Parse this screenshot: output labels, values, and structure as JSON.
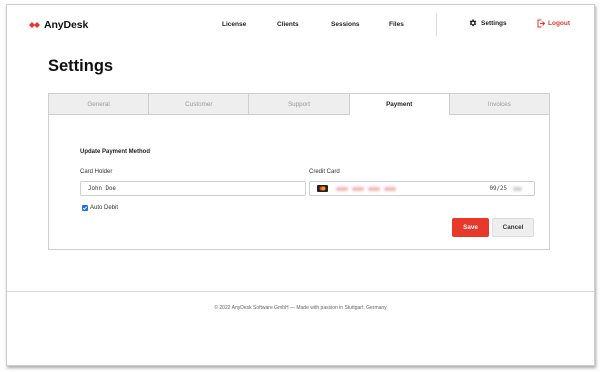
{
  "brand": {
    "name": "AnyDesk",
    "color": "#e8382b"
  },
  "nav": {
    "items": [
      {
        "label": "License"
      },
      {
        "label": "Clients"
      },
      {
        "label": "Sessions"
      },
      {
        "label": "Files"
      }
    ],
    "settings_label": "Settings",
    "logout_label": "Logout"
  },
  "page": {
    "title": "Settings"
  },
  "tabs": [
    {
      "label": "General",
      "active": false
    },
    {
      "label": "Customer",
      "active": false
    },
    {
      "label": "Support",
      "active": false
    },
    {
      "label": "Payment",
      "active": true
    },
    {
      "label": "Invoices",
      "active": false
    }
  ],
  "payment": {
    "section_title": "Update Payment Method",
    "card_holder_label": "Card Holder",
    "card_holder_value": "John Doe",
    "credit_card_label": "Credit Card",
    "card_expiry": "09/25",
    "card_brand_icon": "mastercard-icon",
    "auto_debit_label": "Auto Debit",
    "auto_debit_checked": true,
    "save_label": "Save",
    "cancel_label": "Cancel"
  },
  "footer": {
    "text": "© 2022 AnyDesk Software GmbH — Made with passion in Stuttgart, Germany"
  },
  "colors": {
    "accent": "#e8382b",
    "checkbox": "#1a73e8"
  }
}
